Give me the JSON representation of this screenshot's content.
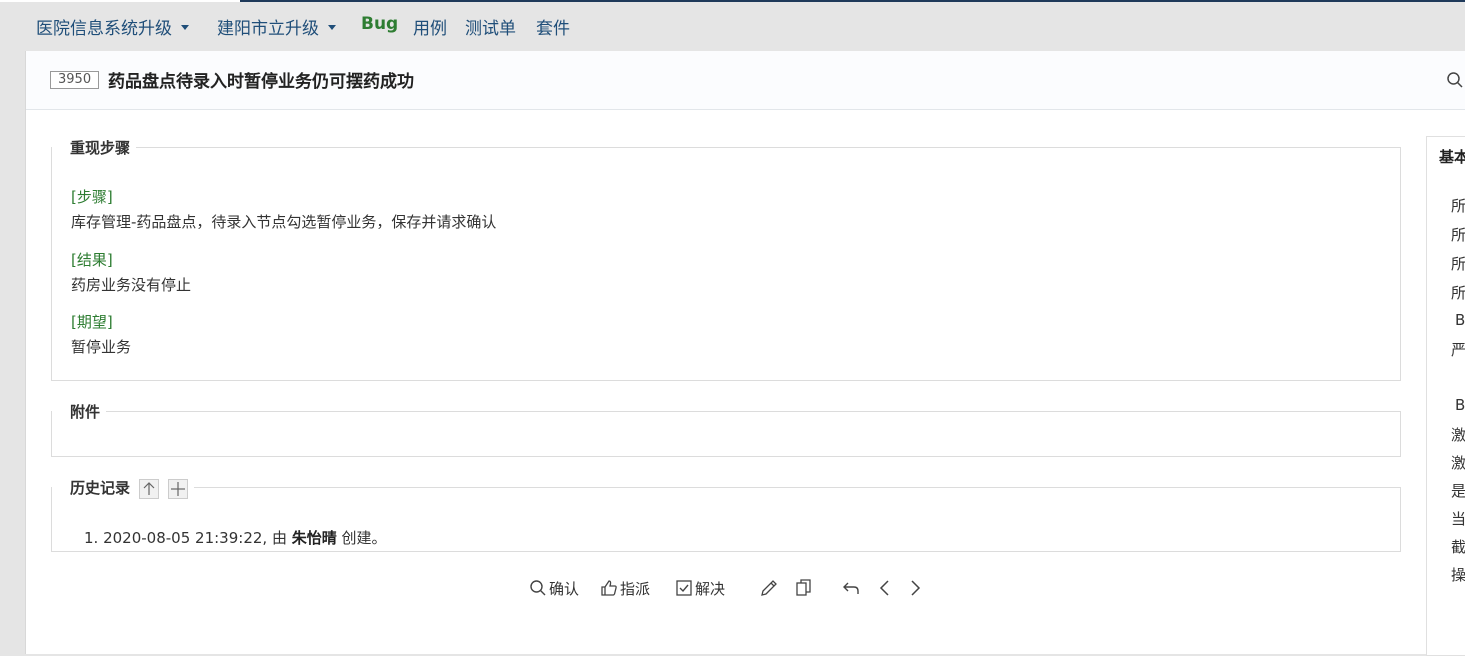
{
  "nav": {
    "product": "医院信息系统升级",
    "project": "建阳市立升级",
    "tabs": [
      "Bug",
      "用例",
      "测试单",
      "套件"
    ]
  },
  "bug": {
    "id": "3950",
    "title": "药品盘点待录入时暂停业务仍可摆药成功"
  },
  "steps": {
    "legend": "重现步骤",
    "step_label": "[步骤]",
    "step_text": "库存管理-药品盘点，待录入节点勾选暂停业务，保存并请求确认",
    "result_label": "[结果]",
    "result_text": "药房业务没有停止",
    "expect_label": "[期望]",
    "expect_text": "暂停业务"
  },
  "attachments": {
    "legend": "附件"
  },
  "history": {
    "legend": "历史记录",
    "entries": [
      {
        "num": "1.",
        "time": "2020-08-05 21:39:22,",
        "by": "由",
        "user": "朱怡晴",
        "action": "创建。"
      }
    ]
  },
  "actions": {
    "confirm": "确认",
    "assign": "指派",
    "resolve": "解决"
  },
  "sidebar": {
    "title": "基本",
    "rows": [
      "所",
      "所",
      "所",
      "所",
      "B",
      "严",
      "B",
      "激",
      "激",
      "是",
      "当",
      "截",
      "操"
    ]
  },
  "colors": {
    "nav_text": "#1f4e79",
    "active_tab": "#2e7d32",
    "label_green": "#2e7d32"
  }
}
